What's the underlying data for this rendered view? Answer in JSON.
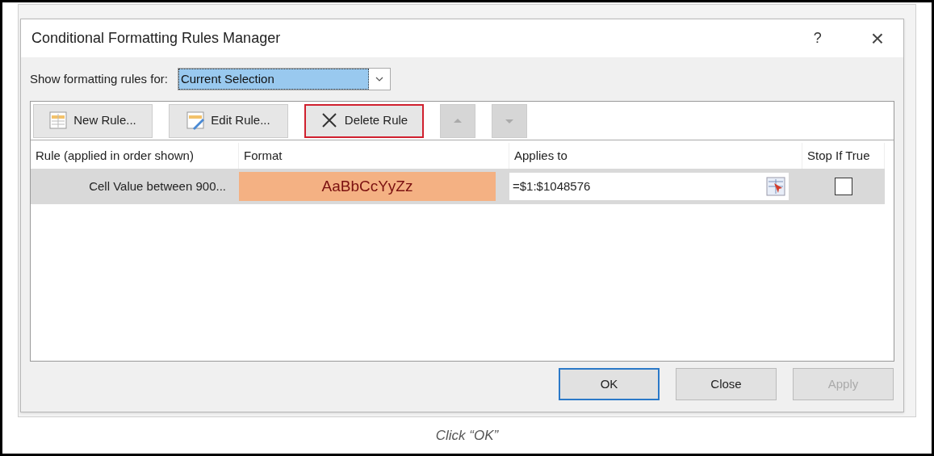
{
  "dialog": {
    "title": "Conditional Formatting Rules Manager",
    "help": "?",
    "close": "×"
  },
  "show_rules_for": {
    "label": "Show formatting rules for:",
    "value": "Current Selection"
  },
  "toolbar": [
    {
      "kind": "new",
      "label": "New Rule...",
      "disabled": false,
      "highlighted": false
    },
    {
      "kind": "edit",
      "label": "Edit Rule...",
      "disabled": false,
      "highlighted": false
    },
    {
      "kind": "delete",
      "label": "Delete Rule",
      "disabled": false,
      "highlighted": true
    },
    {
      "kind": "up",
      "disabled": true,
      "highlighted": false
    },
    {
      "kind": "down",
      "disabled": true,
      "highlighted": false
    }
  ],
  "table": {
    "columns": [
      "Rule (applied in order shown)",
      "Format",
      "Applies to",
      "Stop If True"
    ],
    "rows": [
      {
        "rule": "Cell Value between 900...",
        "format": "AaBbCcYyZz",
        "applies_to": "=$1:$1048576",
        "stop_if_true": false,
        "selected": true
      }
    ]
  },
  "buttons": [
    {
      "label": "OK",
      "default": true,
      "disabled": false
    },
    {
      "label": "Close",
      "default": false,
      "disabled": false
    },
    {
      "label": "Apply",
      "default": false,
      "disabled": true
    }
  ],
  "caption": "Click “OK”"
}
